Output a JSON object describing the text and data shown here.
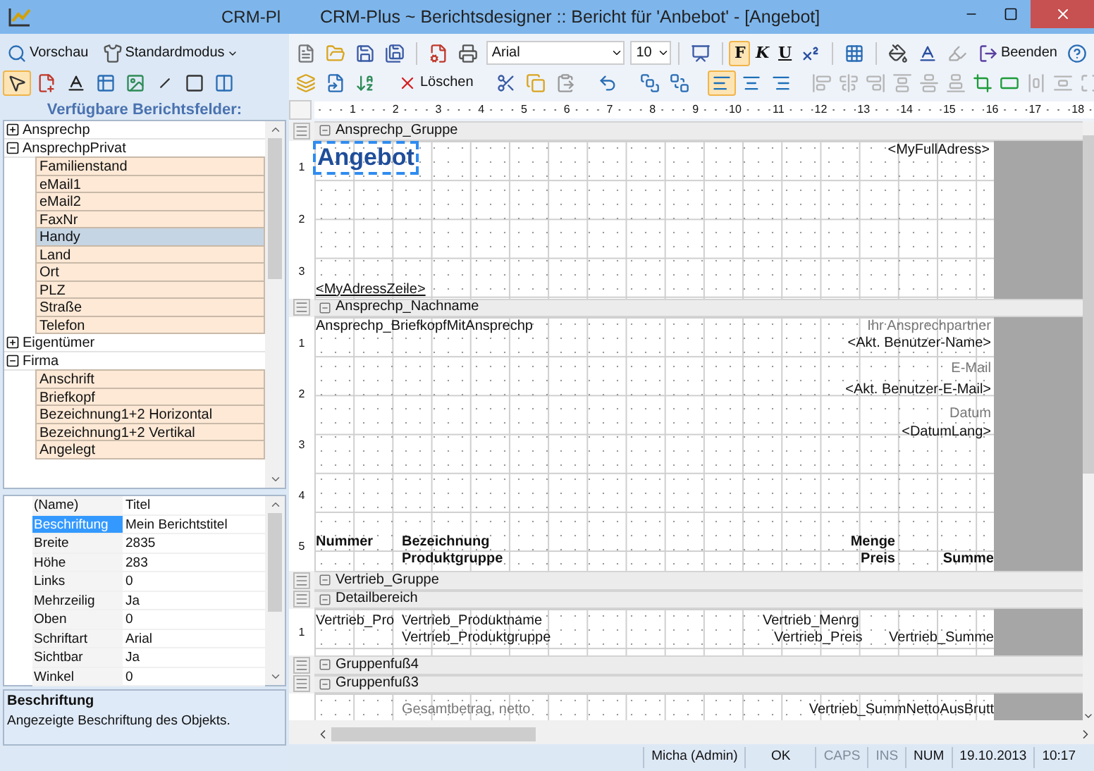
{
  "window": {
    "left_title": "CRM-Pl",
    "title": "CRM-Plus ~ Berichtsdesigner :: Bericht für 'Anbebot' - [Angebot]"
  },
  "left_toolbar": {
    "preview": "Vorschau",
    "mode": "Standardmodus"
  },
  "tools": [
    {
      "kind": "pointer",
      "selected": true
    },
    {
      "kind": "field",
      "selected": false
    },
    {
      "kind": "text",
      "selected": false
    },
    {
      "kind": "table",
      "selected": false
    },
    {
      "kind": "image",
      "selected": false
    },
    {
      "kind": "line",
      "selected": false
    },
    {
      "kind": "rectangle",
      "selected": false
    },
    {
      "kind": "splitter",
      "selected": false
    }
  ],
  "fields_title": "Verfügbare Berichtsfelder:",
  "tree": [
    {
      "label": "Ansprechp",
      "expanded": false
    },
    {
      "label": "AnsprechpPrivat",
      "expanded": true,
      "children": [
        {
          "label": "Familienstand",
          "selected": false
        },
        {
          "label": "eMail1",
          "selected": false
        },
        {
          "label": "eMail2",
          "selected": false
        },
        {
          "label": "FaxNr",
          "selected": false
        },
        {
          "label": "Handy",
          "selected": true
        },
        {
          "label": "Land",
          "selected": false
        },
        {
          "label": "Ort",
          "selected": false
        },
        {
          "label": "PLZ",
          "selected": false
        },
        {
          "label": "Straße",
          "selected": false
        },
        {
          "label": "Telefon",
          "selected": false
        }
      ]
    },
    {
      "label": "Eigentümer",
      "expanded": false
    },
    {
      "label": "Firma",
      "expanded": true,
      "children": [
        {
          "label": "Anschrift",
          "selected": false
        },
        {
          "label": "Briefkopf",
          "selected": false
        },
        {
          "label": "Bezeichnung1+2 Horizontal",
          "selected": false
        },
        {
          "label": "Bezeichnung1+2 Vertikal",
          "selected": false
        },
        {
          "label": "Angelegt",
          "selected": false
        }
      ]
    }
  ],
  "properties": {
    "rows": [
      {
        "name": "(Name)",
        "value": "Titel",
        "selected": false
      },
      {
        "name": "Beschriftung",
        "value": "Mein Berichtstitel",
        "selected": true
      },
      {
        "name": "Breite",
        "value": "2835",
        "selected": false
      },
      {
        "name": "Höhe",
        "value": "283",
        "selected": false
      },
      {
        "name": "Links",
        "value": "0",
        "selected": false
      },
      {
        "name": "Mehrzeilig",
        "value": "Ja",
        "selected": false
      },
      {
        "name": "Oben",
        "value": "0",
        "selected": false
      },
      {
        "name": "Schriftart",
        "value": "Arial",
        "selected": false
      },
      {
        "name": "Sichtbar",
        "value": "Ja",
        "selected": false
      },
      {
        "name": "Winkel",
        "value": "0",
        "selected": false
      }
    ],
    "help_title": "Beschriftung",
    "help_text": "Angezeigte Beschriftung des Objekts."
  },
  "toolbar": {
    "font": "Arial",
    "size": "10",
    "delete": "Löschen",
    "exit": "Beenden",
    "format_buttons": [
      {
        "label": "F",
        "selected": true
      },
      {
        "label": "K",
        "selected": false
      },
      {
        "label": "U",
        "selected": false
      }
    ],
    "align_buttons": [
      {
        "selected": true
      },
      {
        "selected": false
      },
      {
        "selected": false
      }
    ],
    "layout_buttons": [
      {
        "disabled": true
      },
      {
        "disabled": true
      },
      {
        "disabled": true
      },
      {
        "disabled": true
      },
      {
        "disabled": true
      },
      {
        "disabled": true
      },
      {
        "disabled": false
      },
      {
        "disabled": false
      },
      {
        "disabled": true
      },
      {
        "disabled": true
      },
      {
        "disabled": true
      }
    ]
  },
  "ruler": [
    "1",
    "2",
    "3",
    "4",
    "5",
    "6",
    "7",
    "8",
    "9",
    "10",
    "11",
    "12",
    "13",
    "14",
    "15",
    "16",
    "17",
    "18"
  ],
  "sections": [
    {
      "title": "Ansprechp_Gruppe",
      "ruler": [
        "1",
        "2",
        "3"
      ],
      "items": [
        {
          "text": "Angebot",
          "selected": true
        },
        {
          "text": "<MyFullAdress>",
          "selected": false
        },
        {
          "text": "<MyAdressZeile>",
          "selected": false
        }
      ]
    },
    {
      "title": "Ansprechp_Nachname",
      "ruler": [
        "1",
        "2",
        "3",
        "4",
        "5"
      ],
      "items": [
        {
          "text": "Ansprechp_BriefkopfMitAnsprechp",
          "selected": false
        },
        {
          "text": "Ihr Ansprechpartner",
          "selected": false
        },
        {
          "text": "<Akt. Benutzer-Name>",
          "selected": false
        },
        {
          "text": "E-Mail",
          "selected": false
        },
        {
          "text": "<Akt. Benutzer-E-Mail>",
          "selected": false
        },
        {
          "text": "Datum",
          "selected": false
        },
        {
          "text": "<DatumLang>",
          "selected": false
        },
        {
          "text": "Nummer",
          "selected": false
        },
        {
          "text": "Bezeichnung",
          "selected": false
        },
        {
          "text": "Produktgruppe",
          "selected": false
        },
        {
          "text": "Menge",
          "selected": false
        },
        {
          "text": "Preis",
          "selected": false
        },
        {
          "text": "Summe",
          "selected": false
        }
      ]
    },
    {
      "title": "Vertrieb_Gruppe"
    },
    {
      "title": "Detailbereich",
      "ruler": [
        "1"
      ],
      "items": [
        {
          "text": "Vertrieb_Pro",
          "selected": false
        },
        {
          "text": "Vertrieb_Produktname",
          "selected": false
        },
        {
          "text": "Vertrieb_Produktgruppe",
          "selected": false
        },
        {
          "text": "Vertrieb_Menrg",
          "selected": false
        },
        {
          "text": "Vertrieb_Preis",
          "selected": false
        },
        {
          "text": "Vertrieb_Summe",
          "selected": false
        }
      ]
    },
    {
      "title": "Gruppenfuß4"
    },
    {
      "title": "Gruppenfuß3",
      "items": [
        {
          "text": "Gesamtbetrag, netto",
          "selected": false
        },
        {
          "text": "Vertrieb_SummNettoAusBrutt",
          "selected": false
        }
      ]
    }
  ],
  "status": [
    {
      "text": "Micha (Admin)",
      "disabled": false
    },
    {
      "text": "OK",
      "disabled": false
    },
    {
      "text": "CAPS",
      "disabled": true
    },
    {
      "text": "INS",
      "disabled": true
    },
    {
      "text": "NUM",
      "disabled": false
    },
    {
      "text": "19.10.2013",
      "disabled": false
    },
    {
      "text": "10:17",
      "disabled": false
    }
  ]
}
